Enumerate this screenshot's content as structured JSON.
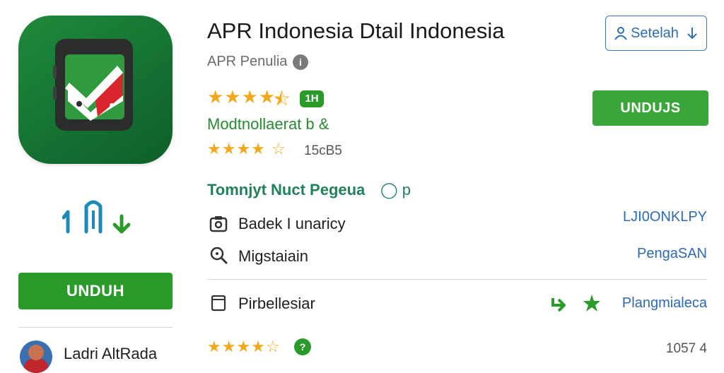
{
  "app": {
    "title": "APR Indonesia Dtail Indonesia",
    "developer": "APR Penulia",
    "info_icon": "i",
    "rating_badge": "1H",
    "tagline": "Modtnollaerat b &",
    "review_count": "15cB5",
    "rating_primary_stars": "★★★★",
    "rating_secondary_stars": "★★★★",
    "rating_bottom_stars": "★★★★☆",
    "rating_bottom_badge": "?",
    "bottom_count": "1057 4"
  },
  "buttons": {
    "setelah_label": "Setelah",
    "unduh_right_label": "UNDUJS",
    "unduh_left_label": "UNDUH"
  },
  "section": {
    "title": "Tomnjyt Nuct Pegeua",
    "extra": "◯ p"
  },
  "rows": [
    {
      "icon": "camera-icon",
      "label": "Badek I unaricy",
      "value": "LJI0ONKLPY"
    },
    {
      "icon": "search-icon",
      "label": "Migstaiain",
      "value": "PengaSAN"
    },
    {
      "icon": "document-icon",
      "label": "Pirbellesiar",
      "value": "Plangmialeca"
    }
  ],
  "user": {
    "name": "Ladri AltRada"
  },
  "colors": {
    "brand_green": "#2a9a2a",
    "icon_bg": "#157233",
    "accent_blue": "#2f6ab0",
    "star": "#f0a91d"
  }
}
